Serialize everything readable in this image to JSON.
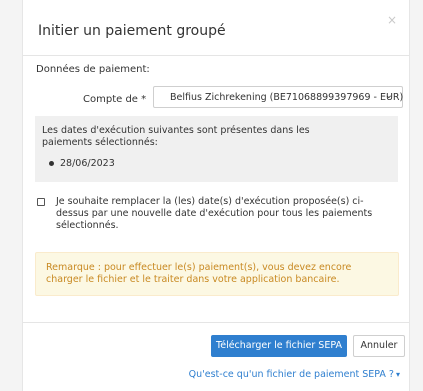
{
  "dialog": {
    "title": "Initier un paiement groupé",
    "close_label": "×"
  },
  "payment_data": {
    "section_label": "Données de paiement:",
    "account_label": "Compte de *",
    "account_value": "Belfius Zichrekening (BE71068899397969 - EUR)"
  },
  "execution_info": {
    "text": "Les dates d'exécution suivantes sont présentes dans les paiements sélectionnés:",
    "dates": [
      "28/06/2023"
    ]
  },
  "replace_date": {
    "checked": false,
    "label": "Je souhaite remplacer la (les) date(s) d'exécution proposée(s) ci-dessus par une nouvelle date d'exécution pour tous les paiements sélectionnés."
  },
  "warning": {
    "text": "Remarque : pour effectuer le(s) paiement(s), vous devez encore charger le fichier et le traiter dans votre application bancaire."
  },
  "footer": {
    "download_label": "Télécharger le fichier SEPA",
    "cancel_label": "Annuler",
    "help_link": "Qu'est-ce qu'un fichier de paiement SEPA ?"
  },
  "colors": {
    "primary": "#2f7fcf",
    "warning_text": "#c88922",
    "warning_bg": "#fcf8e3"
  }
}
